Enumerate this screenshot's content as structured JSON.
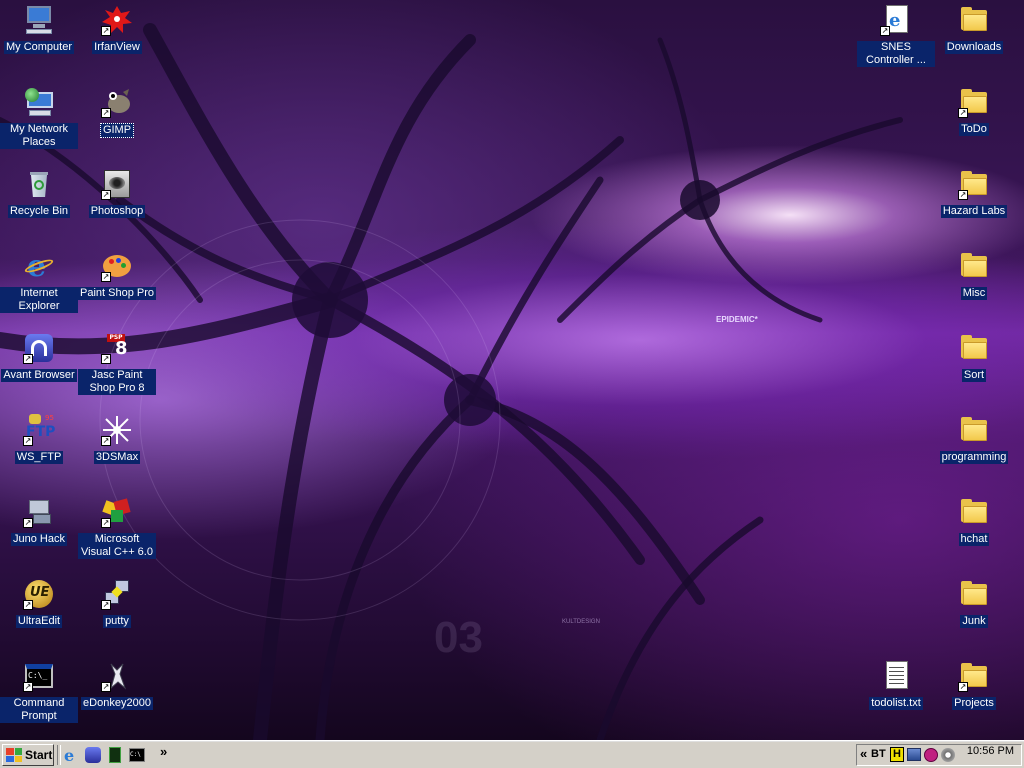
{
  "desktop": {
    "wallpaper_text": "EPIDEMIC*",
    "wallpaper_credit": "KULTDESIGN",
    "icons_left_col1": [
      {
        "label": "My Computer",
        "icon": "computer-icon"
      },
      {
        "label": "My Network Places",
        "icon": "network-icon"
      },
      {
        "label": "Recycle Bin",
        "icon": "recycle-bin-icon"
      },
      {
        "label": "Internet Explorer",
        "icon": "ie-icon"
      },
      {
        "label": "Avant Browser",
        "icon": "avant-icon"
      },
      {
        "label": "WS_FTP",
        "icon": "ftp-icon"
      },
      {
        "label": "Juno Hack",
        "icon": "juno-icon"
      },
      {
        "label": "UltraEdit",
        "icon": "ultraedit-icon"
      },
      {
        "label": "Command Prompt",
        "icon": "cmd-icon"
      }
    ],
    "icons_left_col2": [
      {
        "label": "IrfanView",
        "icon": "irfanview-icon"
      },
      {
        "label": "GIMP",
        "icon": "gimp-icon"
      },
      {
        "label": "Photoshop",
        "icon": "photoshop-icon"
      },
      {
        "label": "Paint Shop Pro",
        "icon": "paintshop-icon"
      },
      {
        "label": "Jasc Paint Shop Pro 8",
        "icon": "psp8-icon"
      },
      {
        "label": "3DSMax",
        "icon": "3dsmax-icon"
      },
      {
        "label": "Microsoft Visual C++ 6.0",
        "icon": "vcpp-icon"
      },
      {
        "label": "putty",
        "icon": "putty-icon"
      },
      {
        "label": "eDonkey2000",
        "icon": "edonkey-icon"
      }
    ],
    "icons_right_col1": [
      {
        "label": "SNES Controller ...",
        "icon": "html-file-icon"
      },
      {
        "label": "todolist.txt",
        "icon": "text-file-icon"
      }
    ],
    "icons_right_col2": [
      {
        "label": "Downloads",
        "icon": "folder-icon"
      },
      {
        "label": "ToDo",
        "icon": "folder-icon"
      },
      {
        "label": "Hazard Labs",
        "icon": "folder-icon"
      },
      {
        "label": "Misc",
        "icon": "folder-icon"
      },
      {
        "label": "Sort",
        "icon": "folder-icon"
      },
      {
        "label": "programming",
        "icon": "folder-icon"
      },
      {
        "label": "hchat",
        "icon": "folder-icon"
      },
      {
        "label": "Junk",
        "icon": "folder-icon"
      },
      {
        "label": "Projects",
        "icon": "folder-icon"
      }
    ]
  },
  "taskbar": {
    "start_label": "Start",
    "quick_launch": [
      "ie-icon",
      "avant-icon",
      "terminal-icon",
      "cmd-icon"
    ],
    "chevron": "»",
    "tray_chevron": "«",
    "tray_bt_label": "BT",
    "clock": "10:56 PM"
  },
  "colors": {
    "label_bg": "#0a246a",
    "taskbar": "#d4d0c8",
    "wallpaper_purple": "#6b2a9a"
  }
}
